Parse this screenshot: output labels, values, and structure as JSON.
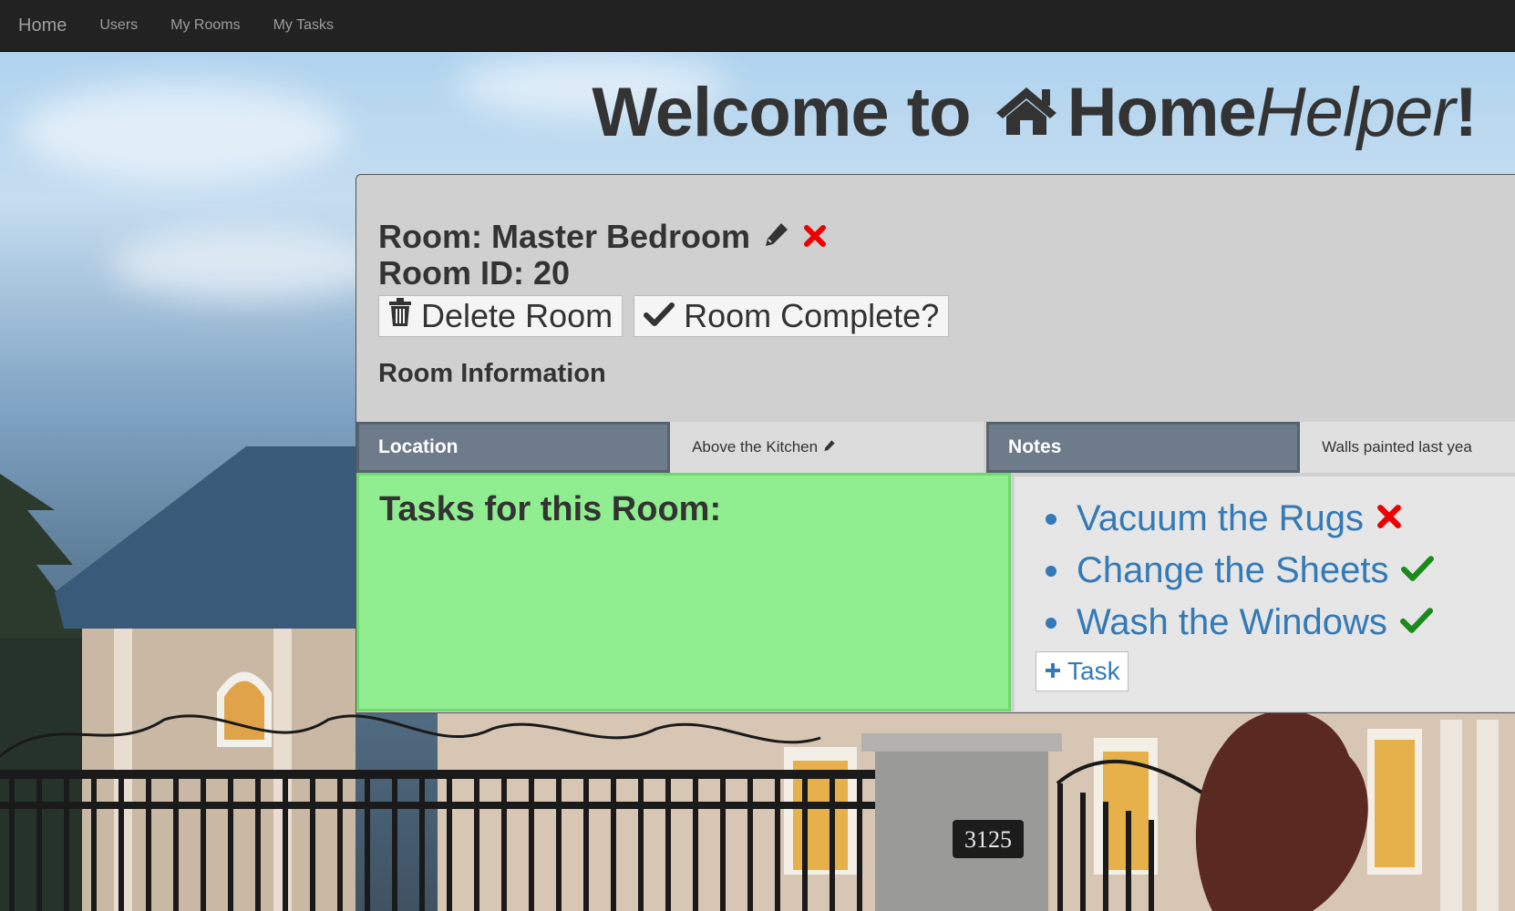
{
  "nav": {
    "brand": "Home",
    "links": [
      "Users",
      "My Rooms",
      "My Tasks"
    ]
  },
  "headline": {
    "prefix": "Welcome to",
    "home": "Home",
    "helper": "Helper",
    "suffix": "!"
  },
  "room": {
    "name_line": "Room: Master Bedroom",
    "id_line": "Room ID: 20",
    "delete_label": "Delete Room",
    "complete_label": "Room Complete?",
    "info_label": "Room Information"
  },
  "info": {
    "location_label": "Location",
    "location_value": "Above the Kitchen",
    "notes_label": "Notes",
    "notes_value": "Walls painted last yea"
  },
  "tasks": {
    "title": "Tasks for this Room:",
    "items": [
      {
        "label": "Vacuum the Rugs",
        "status": "delete"
      },
      {
        "label": "Change the Sheets",
        "status": "complete"
      },
      {
        "label": "Wash the Windows",
        "status": "complete"
      }
    ],
    "add_label": "Task"
  },
  "colors": {
    "navbar": "#222222",
    "link": "#337ab7",
    "tasks_bg": "#90ee90",
    "header_cell": "#6d7b8a",
    "delete_red": "#ee0000",
    "check_green": "#1a8a1a"
  },
  "icons": {
    "headline": "home-icon",
    "edit": "pencil-icon",
    "remove": "x-icon",
    "delete": "trash-icon",
    "complete": "checkmark-icon",
    "add": "plus-icon"
  }
}
